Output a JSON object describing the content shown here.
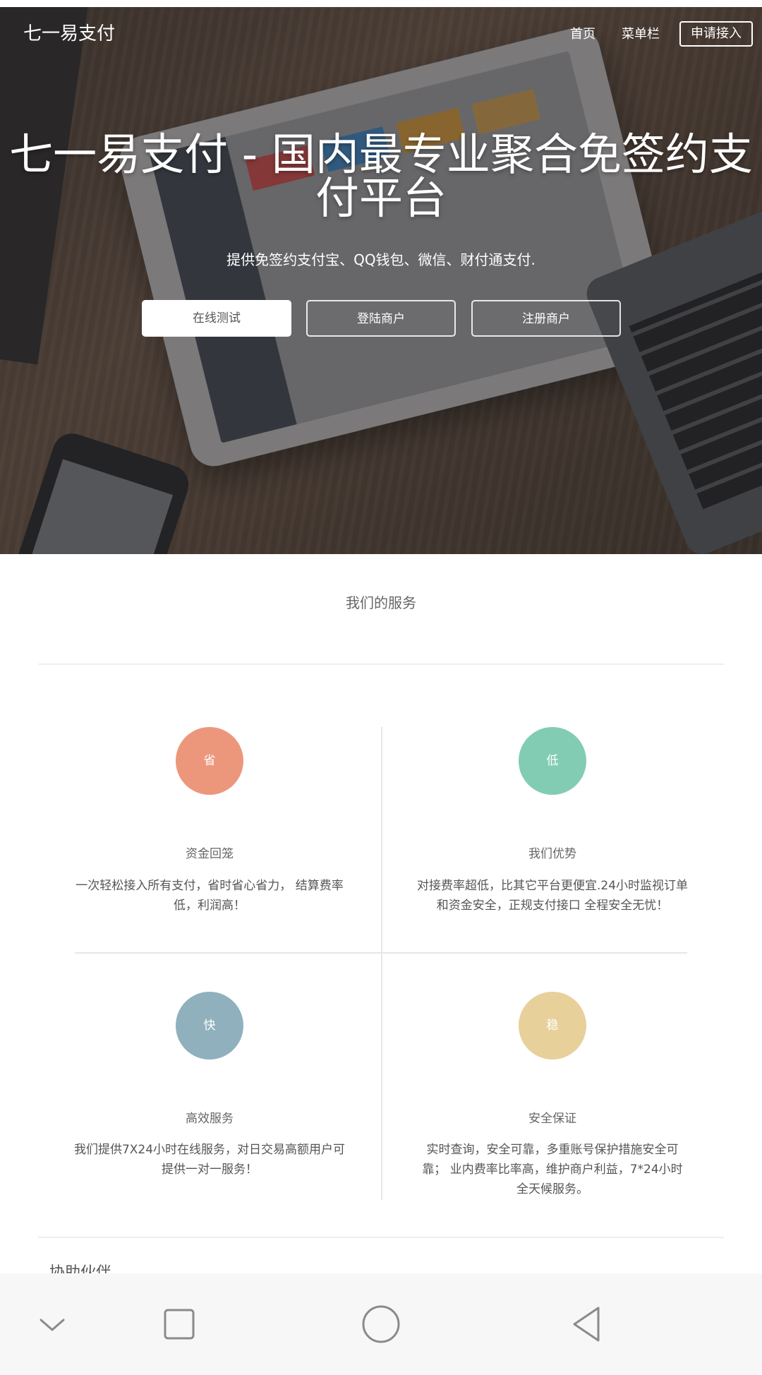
{
  "header": {
    "brand": "七一易支付",
    "nav": {
      "home": "首页",
      "menu": "菜单栏",
      "apply": "申请接入"
    }
  },
  "hero": {
    "title": "七一易支付 - 国内最专业聚合免签约支付平台",
    "subtitle": "提供免签约支付宝、QQ钱包、微信、财付通支付.",
    "buttons": {
      "test": "在线测试",
      "login": "登陆商户",
      "register": "注册商户"
    }
  },
  "services": {
    "title": "我们的服务",
    "cards": [
      {
        "icon_char": "省",
        "color": "#ec977c",
        "title": "资金回笼",
        "desc": "一次轻松接入所有支付，省时省心省力， 结算费率低，利润高！"
      },
      {
        "icon_char": "低",
        "color": "#82ccb4",
        "title": "我们优势",
        "desc": "对接费率超低，比其它平台更便宜.24小时监视订单 和资金安全，正规支付接口 全程安全无忧！"
      },
      {
        "icon_char": "快",
        "color": "#90b0bd",
        "title": "高效服务",
        "desc": "我们提供7X24小时在线服务，对日交易高额用户可提供一对一服务！"
      },
      {
        "icon_char": "稳",
        "color": "#e8d09b",
        "title": "安全保证",
        "desc": "实时查询，安全可靠，多重账号保护措施安全可靠； 业内费率比率高，维护商户利益，7*24小时全天候服务。"
      }
    ]
  },
  "partners": {
    "title": "协助伙伴"
  },
  "system_nav": {
    "icons": [
      "chevron-down-icon",
      "square-icon",
      "circle-home-icon",
      "triangle-back-icon"
    ]
  }
}
